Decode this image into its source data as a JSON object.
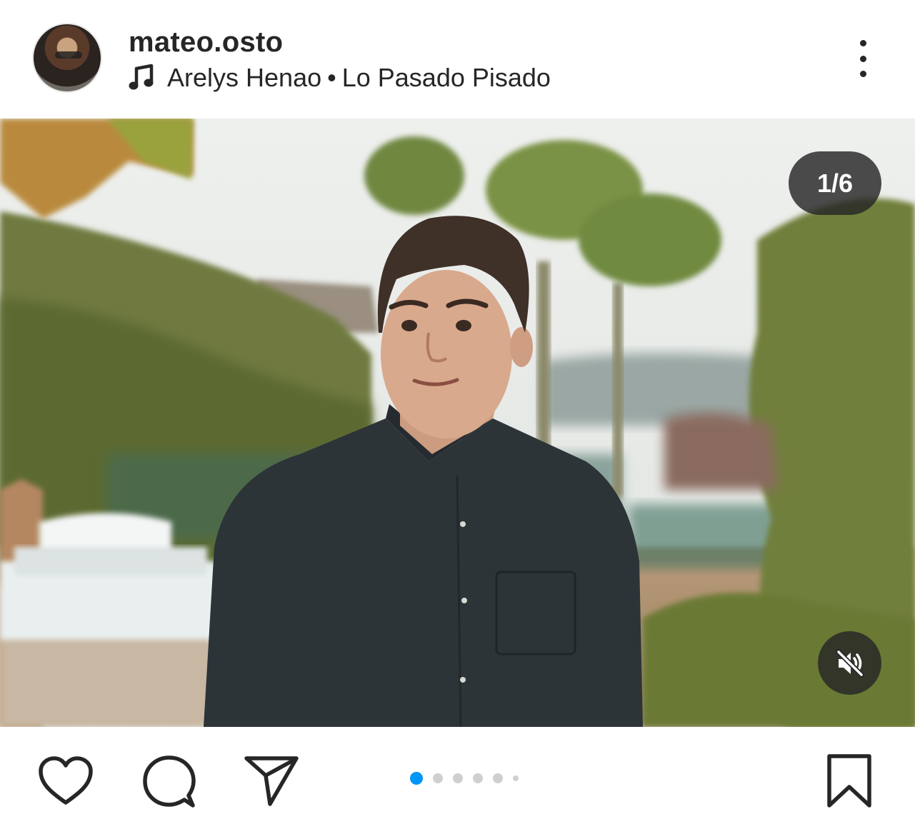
{
  "post": {
    "username": "mateo.osto",
    "music": {
      "artist": "Arelys Henao",
      "separator": "•",
      "song": "Lo Pasado Pisado"
    },
    "carousel_counter": "1/6",
    "carousel": {
      "current": 1,
      "total": 6
    }
  },
  "icons": {
    "more": "more-options-icon",
    "music": "music-note-icon",
    "mute": "speaker-muted-icon",
    "like": "heart-icon",
    "comment": "comment-bubble-icon",
    "share": "paper-plane-icon",
    "save": "bookmark-icon"
  },
  "colors": {
    "text": "#262626",
    "active_dot": "#0095f6",
    "inactive_dot": "#cfcfcf",
    "overlay": "#262626"
  }
}
